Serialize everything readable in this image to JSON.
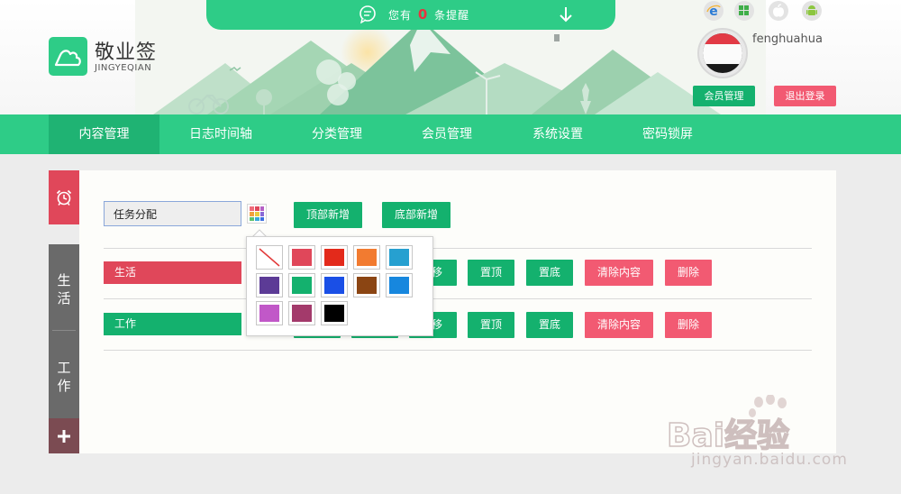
{
  "header": {
    "notice_prefix": "您有",
    "notice_count": "0",
    "notice_suffix": "条提醒",
    "logo_title": "敬业签",
    "logo_subtitle": "JINGYEQIAN",
    "platform_icons": [
      "ie-icon",
      "windows-icon",
      "apple-icon",
      "android-icon"
    ],
    "username": "fenghuahua",
    "member_button": "会员管理",
    "logout_button": "退出登录"
  },
  "nav": {
    "items": [
      {
        "label": "内容管理",
        "active": true
      },
      {
        "label": "日志时间轴",
        "active": false
      },
      {
        "label": "分类管理",
        "active": false
      },
      {
        "label": "会员管理",
        "active": false
      },
      {
        "label": "系统设置",
        "active": false
      },
      {
        "label": "密码锁屏",
        "active": false
      }
    ]
  },
  "sidebar": {
    "tabs": [
      {
        "icon": "alarm-clock-icon"
      },
      {
        "label": "生活"
      },
      {
        "label": "工作"
      },
      {
        "icon": "plus-icon"
      }
    ]
  },
  "main": {
    "new_category_input": "任务分配",
    "add_top_button": "顶部新增",
    "add_bottom_button": "底部新增",
    "categories": [
      {
        "name": "生活",
        "color": "#e0475a"
      },
      {
        "name": "工作",
        "color": "#14b16e"
      }
    ],
    "row_actions": {
      "move_partial": "移",
      "pin_top": "置顶",
      "pin_bottom": "置底",
      "clear": "清除内容",
      "delete": "删除"
    }
  },
  "color_picker": {
    "swatches": [
      "none",
      "#e0475a",
      "#e32a1b",
      "#f27b30",
      "#26a0d0",
      "#5c3b96",
      "#14b16e",
      "#1a4fe6",
      "#8b4513",
      "#1787de",
      "#c158c8",
      "#a33a6b",
      "#000000"
    ]
  },
  "watermark": {
    "brand": "Bai经验",
    "url": "jingyan.baidu.com"
  },
  "colors": {
    "primary": "#2ecc87",
    "primary_dark": "#14b16e",
    "danger": "#f25a72",
    "alarm": "#e0475a"
  }
}
